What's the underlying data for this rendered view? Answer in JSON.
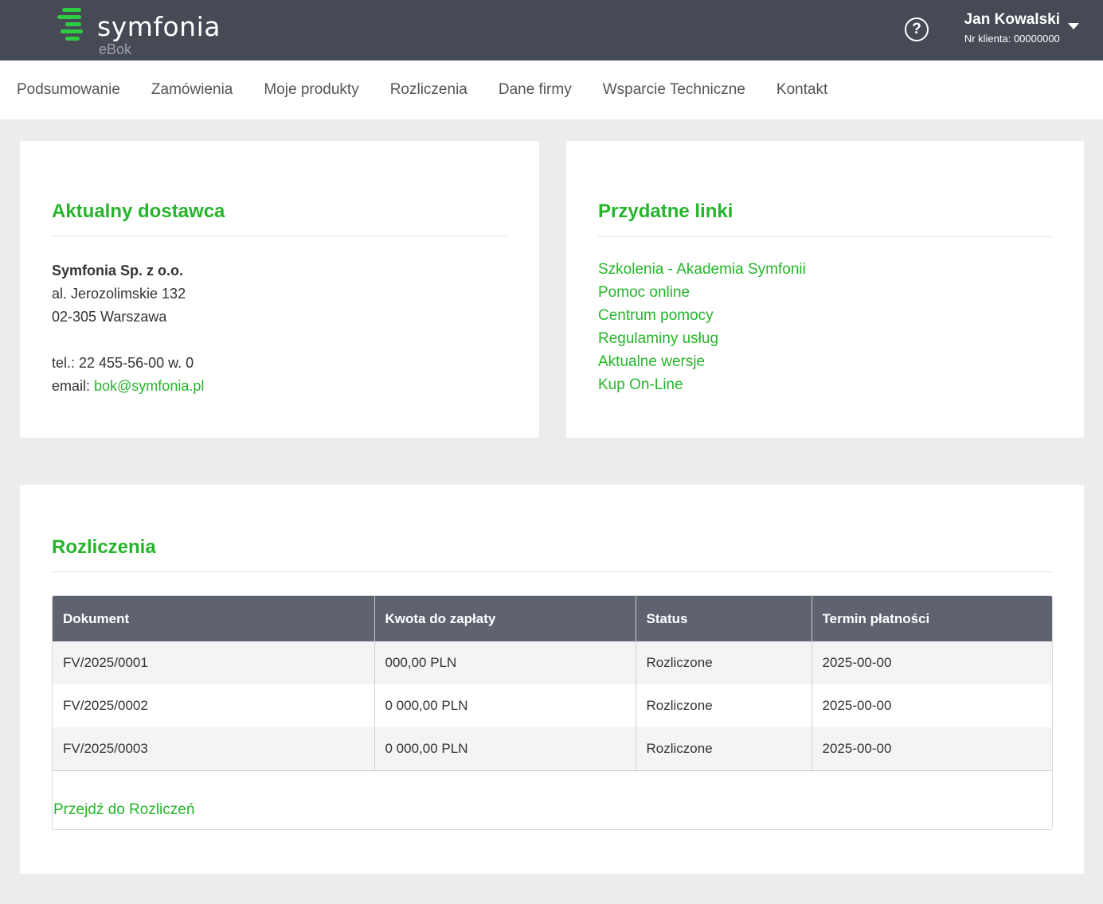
{
  "header": {
    "brand": "symfonia",
    "sub": "eBok",
    "help_symbol": "?",
    "user_name": "Jan Kowalski",
    "client_label": "Nr klienta: 00000000",
    "logo_color": "#2ecc40"
  },
  "nav": {
    "items": [
      "Podsumowanie",
      "Zamówienia",
      "Moje produkty",
      "Rozliczenia",
      "Dane firmy",
      "Wsparcie Techniczne",
      "Kontakt"
    ]
  },
  "supplier": {
    "title": "Aktualny dostawca",
    "company": "Symfonia Sp. z o.o.",
    "street": "al. Jerozolimskie 132",
    "city": "02-305 Warszawa",
    "phone": "tel.: 22 455-56-00 w. 0",
    "email_label": "email: ",
    "email": "bok@symfonia.pl"
  },
  "links": {
    "title": "Przydatne linki",
    "items": [
      "Szkolenia - Akademia Symfonii",
      "Pomoc online",
      "Centrum pomocy",
      "Regulaminy usług",
      "Aktualne wersje",
      "Kup On-Line"
    ]
  },
  "billing": {
    "title": "Rozliczenia",
    "columns": [
      "Dokument",
      "Kwota do zapłaty",
      "Status",
      "Termin płatności"
    ],
    "rows": [
      [
        "FV/2025/0001",
        "000,00 PLN",
        "Rozliczone",
        "2025-00-00"
      ],
      [
        "FV/2025/0002",
        "0 000,00 PLN",
        "Rozliczone",
        "2025-00-00"
      ],
      [
        "FV/2025/0003",
        "0 000,00 PLN",
        "Rozliczone",
        "2025-00-00"
      ]
    ],
    "goto_link": "Przejdź do Rozliczeń"
  },
  "colors": {
    "accent": "#25b52a",
    "header_bg": "#454a55",
    "table_header_bg": "#5f6370"
  }
}
